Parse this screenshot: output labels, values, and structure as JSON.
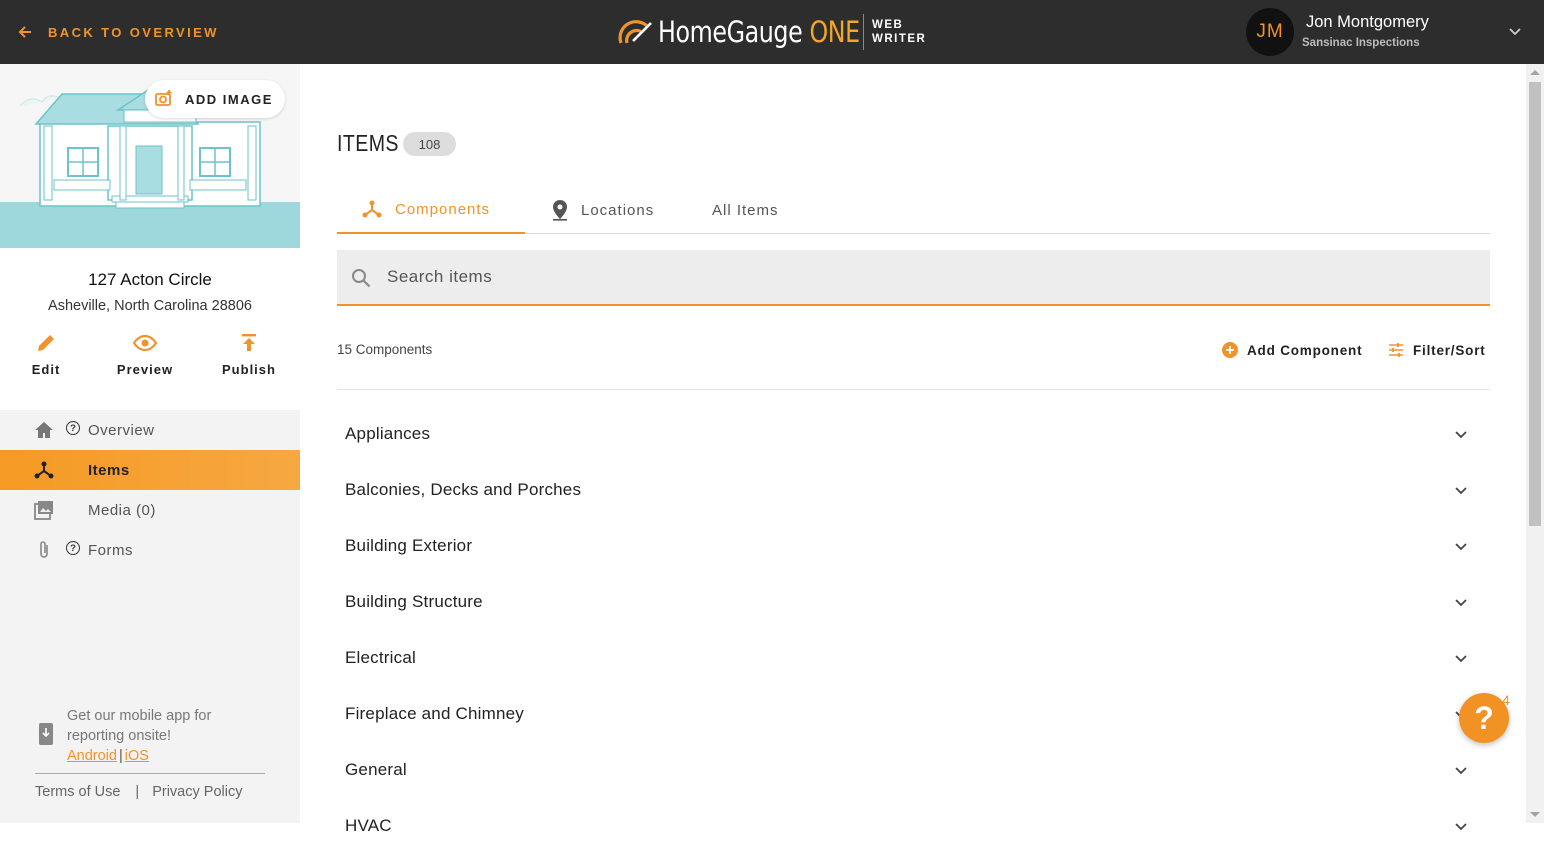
{
  "header": {
    "back_label": "BACK TO OVERVIEW",
    "brand_primary": "HomeGauge",
    "brand_accent": "ONE",
    "product_line1": "WEB",
    "product_line2": "WRITER",
    "user_initials": "JM",
    "user_name": "Jon Montgomery",
    "user_company": "Sansinac Inspections"
  },
  "sidebar": {
    "add_image_label": "ADD IMAGE",
    "street": "127 Acton Circle",
    "city_line": "Asheville,  North Carolina 28806",
    "actions": [
      {
        "label": "Edit",
        "icon": "pencil-icon"
      },
      {
        "label": "Preview",
        "icon": "eye-icon"
      },
      {
        "label": "Publish",
        "icon": "upload-icon"
      }
    ],
    "nav": [
      {
        "label": "Overview",
        "icon": "home-icon",
        "help": true,
        "active": false
      },
      {
        "label": "Items",
        "icon": "components-icon",
        "help": false,
        "active": true
      },
      {
        "label": "Media (0)",
        "icon": "images-icon",
        "help": false,
        "active": false
      },
      {
        "label": "Forms",
        "icon": "paperclip-icon",
        "help": true,
        "active": false
      }
    ],
    "help_glyph": "?",
    "mobile_text": "Get our mobile app for reporting onsite!",
    "android_label": "Android",
    "separator": "|",
    "ios_label": "iOS",
    "terms_label": "Terms of Use",
    "footer_separator": "|",
    "privacy_label": "Privacy Policy"
  },
  "main": {
    "title": "ITEMS",
    "item_count": "108",
    "tabs": [
      {
        "label": "Components",
        "icon": "components-icon",
        "active": true
      },
      {
        "label": "Locations",
        "icon": "map-pin-icon",
        "active": false
      },
      {
        "label": "All Items",
        "icon": "",
        "active": false
      }
    ],
    "search_placeholder": "Search items",
    "components_count": "15 Components",
    "add_component_label": "Add Component",
    "filter_sort_label": "Filter/Sort",
    "components": [
      "Appliances",
      "Balconies, Decks and Porches",
      "Building Exterior",
      "Building Structure",
      "Electrical",
      "Fireplace and Chimney",
      "General",
      "HVAC"
    ]
  },
  "help_widget": {
    "glyph": "?",
    "badge": "4"
  },
  "colors": {
    "accent": "#f0932b",
    "topbar": "#2d2d2d",
    "sidebar": "#f3f3f3",
    "hero_sky": "#9fd8dc"
  }
}
